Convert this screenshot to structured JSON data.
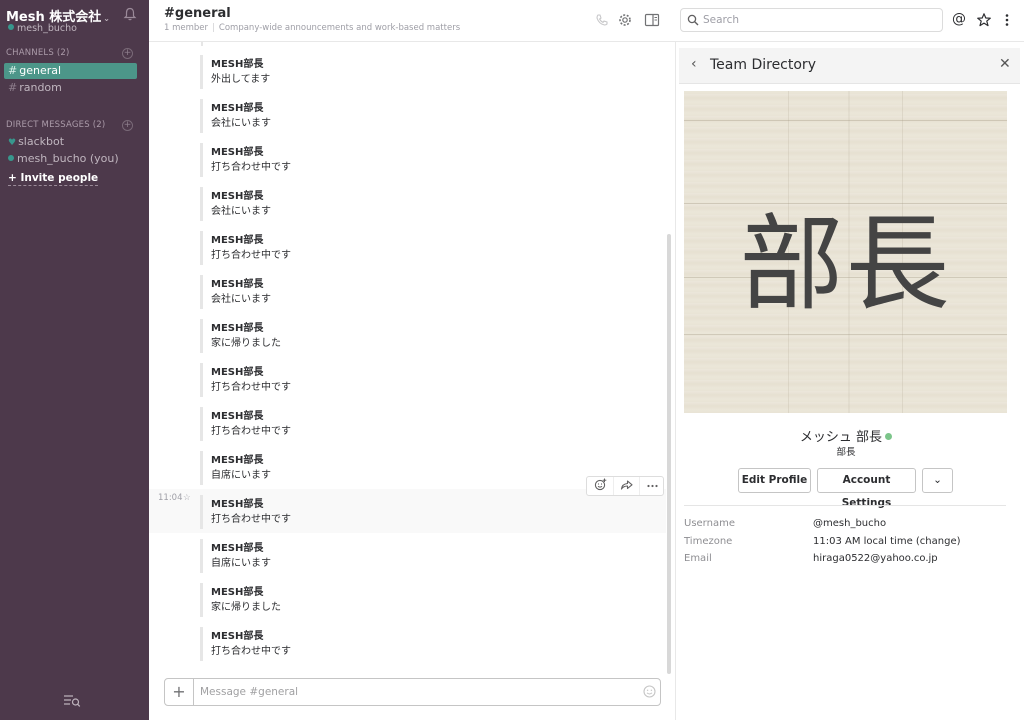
{
  "team": {
    "name": "Mesh 株式会社",
    "caret": "⌄",
    "username": "mesh_bucho"
  },
  "sidebar": {
    "channels_label": "CHANNELS",
    "channels_count": "(2)",
    "channels": [
      {
        "name": "general",
        "active": true
      },
      {
        "name": "random",
        "active": false
      }
    ],
    "dm_label": "DIRECT MESSAGES",
    "dm_count": "(2)",
    "dms": [
      "slackbot",
      "mesh_bucho (you)"
    ],
    "invite_label": "+ Invite people"
  },
  "header": {
    "title": "#general",
    "members": "1 member",
    "purpose": "Company-wide announcements and work-based matters",
    "search_placeholder": "Search"
  },
  "messages": [
    {
      "author": "MESH部長",
      "text": "外出してます"
    },
    {
      "author": "MESH部長",
      "text": "会社にいます"
    },
    {
      "author": "MESH部長",
      "text": "打ち合わせ中です"
    },
    {
      "author": "MESH部長",
      "text": "会社にいます"
    },
    {
      "author": "MESH部長",
      "text": "打ち合わせ中です"
    },
    {
      "author": "MESH部長",
      "text": "会社にいます"
    },
    {
      "author": "MESH部長",
      "text": "家に帰りました"
    },
    {
      "author": "MESH部長",
      "text": "打ち合わせ中です"
    },
    {
      "author": "MESH部長",
      "text": "打ち合わせ中です"
    },
    {
      "author": "MESH部長",
      "text": "自席にいます"
    },
    {
      "author": "MESH部長",
      "text": "打ち合わせ中です",
      "time": "11:04"
    },
    {
      "author": "MESH部長",
      "text": "自席にいます"
    },
    {
      "author": "MESH部長",
      "text": "家に帰りました"
    },
    {
      "author": "MESH部長",
      "text": "打ち合わせ中です"
    }
  ],
  "message_actions": [
    "add-reaction-icon",
    "share-icon",
    "more-icon"
  ],
  "composer": {
    "plus": "+",
    "placeholder": "Message #general"
  },
  "panel": {
    "back": "‹",
    "title": "Team Directory",
    "close": "✕",
    "avatar_text": "部長",
    "display_name": "メッシュ 部長",
    "title_text": "部長",
    "edit_profile": "Edit Profile",
    "account_settings": "Account Settings",
    "more": "⌄",
    "fields": [
      {
        "label": "Username",
        "value": "@mesh_bucho"
      },
      {
        "label": "Timezone",
        "value": "11:03 AM local time (change)"
      },
      {
        "label": "Email",
        "value": "hiraga0522@yahoo.co.jp"
      }
    ]
  },
  "colors": {
    "sidebar_bg": "#4d394b",
    "active_channel": "#4c9689",
    "presence": "#38978d",
    "online": "#7cc58a"
  }
}
